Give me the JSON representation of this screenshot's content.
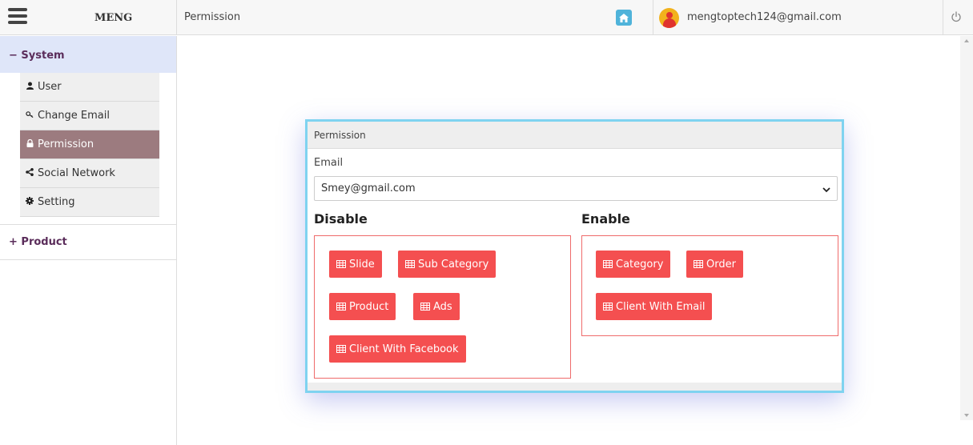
{
  "header": {
    "brand": "MENG",
    "page_title": "Permission",
    "user_email": "mengtoptech124@gmail.com",
    "icons": [
      "hamburger-icon",
      "home-icon",
      "user-avatar",
      "power-icon"
    ]
  },
  "sidebar": {
    "system_label": "− System",
    "items": [
      {
        "label": "User",
        "icon": "user-icon"
      },
      {
        "label": "Change Email",
        "icon": "key-icon"
      },
      {
        "label": "Permission",
        "icon": "lock-icon",
        "active": true
      },
      {
        "label": "Social Network",
        "icon": "share-icon"
      },
      {
        "label": "Setting",
        "icon": "gear-icon"
      }
    ],
    "product_label": "+ Product"
  },
  "panel": {
    "title": "Permission",
    "email_label": "Email",
    "email_selected": "Smey@gmail.com",
    "disable_title": "Disable",
    "enable_title": "Enable",
    "disable_buttons": [
      "Slide",
      "Sub Category",
      "Product",
      "Ads",
      "Client With Facebook"
    ],
    "enable_buttons": [
      "Category",
      "Order",
      "Client With Email"
    ]
  },
  "colors": {
    "accent_red": "#f44f50",
    "active_menu": "#9c7b7f",
    "panel_border": "#7fd3f0",
    "home_button": "#4fb3da"
  }
}
